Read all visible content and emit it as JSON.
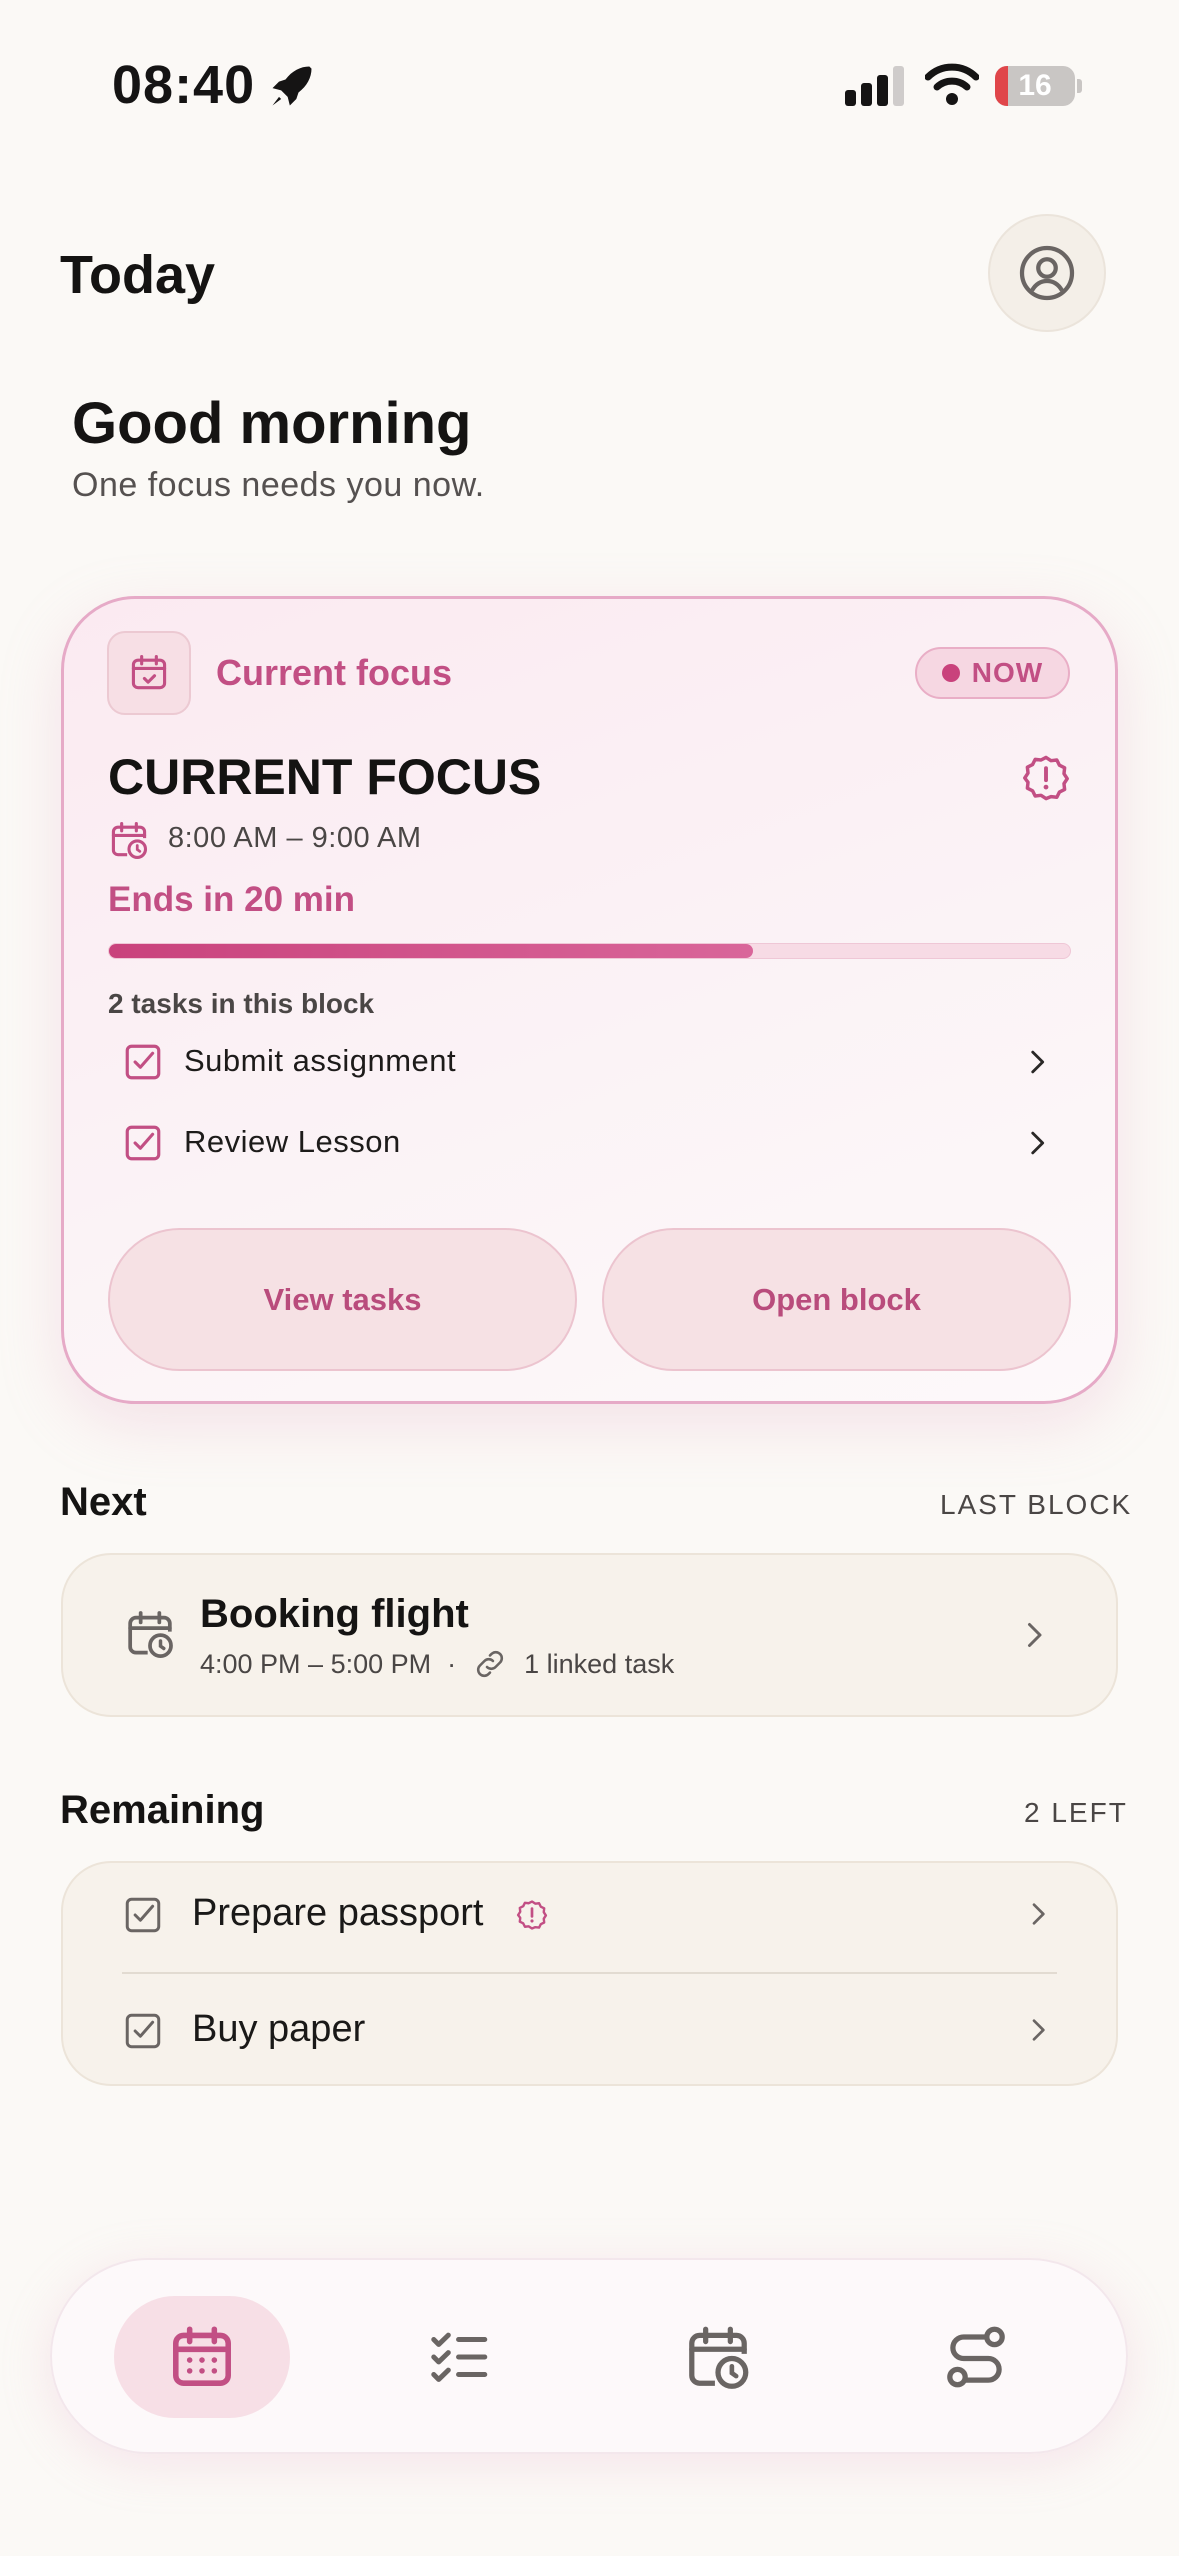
{
  "status_bar": {
    "time": "08:40",
    "battery": "16",
    "battery_level_percent": 16
  },
  "header": {
    "title": "Today"
  },
  "greeting": {
    "title": "Good morning",
    "subtitle": "One focus needs you now."
  },
  "focus_card": {
    "label": "Current focus",
    "badge": "NOW",
    "title": "CURRENT FOCUS",
    "time_range": "8:00 AM – 9:00 AM",
    "ends_text": "Ends in 20 min",
    "progress_percent": 67,
    "tasks_count_text": "2 tasks in this block",
    "tasks": [
      {
        "label": "Submit assignment"
      },
      {
        "label": "Review Lesson"
      }
    ],
    "view_tasks_label": "View tasks",
    "open_block_label": "Open block"
  },
  "next": {
    "title": "Next",
    "meta": "LAST BLOCK",
    "block_title": "Booking flight",
    "block_time": "4:00 PM – 5:00 PM",
    "separator": "·",
    "linked": "1 linked task"
  },
  "remaining": {
    "title": "Remaining",
    "meta": "2 LEFT",
    "items": [
      {
        "label": "Prepare passport"
      },
      {
        "label": "Buy paper"
      }
    ]
  },
  "tabbar": {
    "tabs": [
      {
        "icon": "calendar-icon",
        "active": true
      },
      {
        "icon": "checklist-icon",
        "active": false
      },
      {
        "icon": "calendar-clock-icon",
        "active": false
      },
      {
        "icon": "routes-icon",
        "active": false
      }
    ]
  },
  "colors": {
    "accent": "#c24f84",
    "background": "#fbf9f6",
    "card": "#f7f2eb"
  }
}
